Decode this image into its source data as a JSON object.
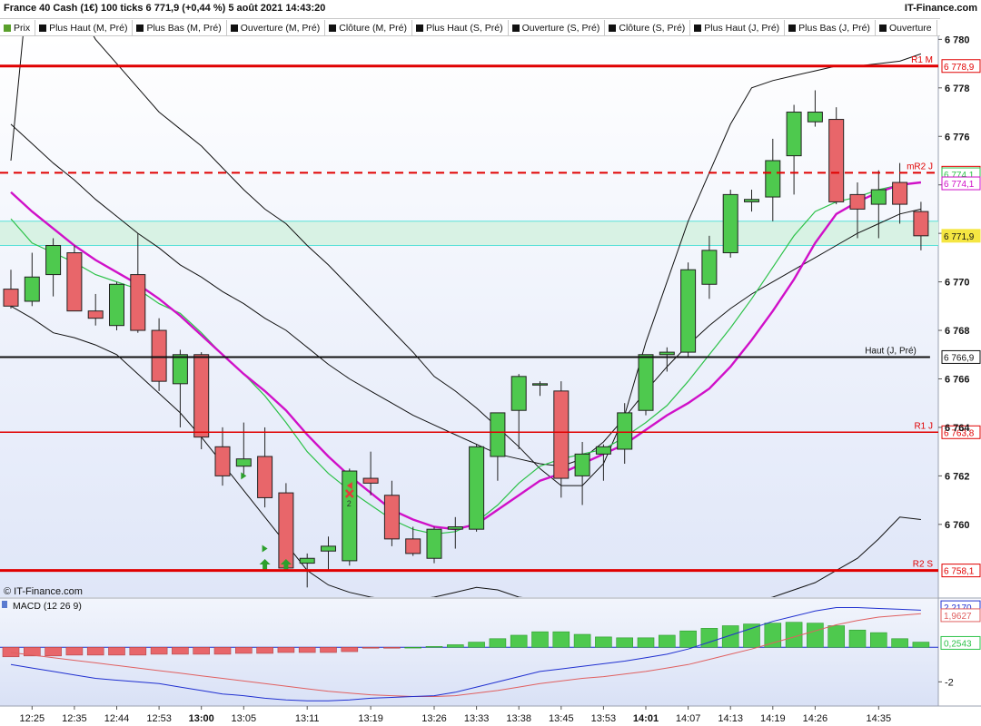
{
  "header": {
    "title": "France 40 Cash (1€) 100 ticks 6 771,9 (+0,44 %) 5 août 2021 14:43:20",
    "brand": "IT-Finance.com"
  },
  "legend": [
    {
      "label": "Prix",
      "color": "#5aa02c"
    },
    {
      "label": "Plus Haut (M, Pré)",
      "color": "#111111"
    },
    {
      "label": "Plus Bas (M, Pré)",
      "color": "#111111"
    },
    {
      "label": "Ouverture (M, Pré)",
      "color": "#111111"
    },
    {
      "label": "Clôture (M, Pré)",
      "color": "#111111"
    },
    {
      "label": "Plus Haut (S, Pré)",
      "color": "#111111"
    },
    {
      "label": "Ouverture (S, Pré)",
      "color": "#111111"
    },
    {
      "label": "Clôture (S, Pré)",
      "color": "#111111"
    },
    {
      "label": "Plus Haut (J, Pré)",
      "color": "#111111"
    },
    {
      "label": "Plus Bas (J, Pré)",
      "color": "#111111"
    },
    {
      "label": "Ouverture",
      "color": "#111111"
    }
  ],
  "colors": {
    "up": "#4ec94e",
    "down": "#e8666a",
    "pivot_red": "#e00000",
    "bollinger": "#111111",
    "ma_fast": "#2ec24a",
    "ma_slow": "#d010c8",
    "band_fill": "#d8f2e4",
    "band_edge": "#58e0d8",
    "macd_line": "#2030d0",
    "signal_line": "#e06060",
    "price_tag": "#f5e642"
  },
  "chart_data": {
    "type": "candlestick",
    "instrument": "France 40 Cash (1€) 100 ticks",
    "y_ticks": [
      {
        "value": 6760,
        "label": "6 760"
      },
      {
        "value": 6762,
        "label": "6 762"
      },
      {
        "value": 6764,
        "label": "6 764"
      },
      {
        "value": 6766,
        "label": "6 766"
      },
      {
        "value": 6768,
        "label": "6 768"
      },
      {
        "value": 6770,
        "label": "6 770"
      },
      {
        "value": 6772,
        "label": "6 772"
      },
      {
        "value": 6774,
        "label": "6 774"
      },
      {
        "value": 6776,
        "label": "6 776"
      },
      {
        "value": 6778,
        "label": "6 778"
      },
      {
        "value": 6780,
        "label": "6 780"
      }
    ],
    "ylim": [
      6757.0,
      6780.5
    ],
    "x_labels": [
      {
        "i": 1,
        "label": "12:25",
        "bold": false
      },
      {
        "i": 3,
        "label": "12:35",
        "bold": false
      },
      {
        "i": 5,
        "label": "12:44",
        "bold": false
      },
      {
        "i": 7,
        "label": "12:53",
        "bold": false
      },
      {
        "i": 9,
        "label": "13:00",
        "bold": true
      },
      {
        "i": 11,
        "label": "13:05",
        "bold": false
      },
      {
        "i": 14,
        "label": "13:11",
        "bold": false
      },
      {
        "i": 17,
        "label": "13:19",
        "bold": false
      },
      {
        "i": 20,
        "label": "13:26",
        "bold": false
      },
      {
        "i": 22,
        "label": "13:33",
        "bold": false
      },
      {
        "i": 24,
        "label": "13:38",
        "bold": false
      },
      {
        "i": 26,
        "label": "13:45",
        "bold": false
      },
      {
        "i": 28,
        "label": "13:53",
        "bold": false
      },
      {
        "i": 30,
        "label": "14:01",
        "bold": true
      },
      {
        "i": 32,
        "label": "14:07",
        "bold": false
      },
      {
        "i": 34,
        "label": "14:13",
        "bold": false
      },
      {
        "i": 36,
        "label": "14:19",
        "bold": false
      },
      {
        "i": 38,
        "label": "14:26",
        "bold": false
      },
      {
        "i": 41,
        "label": "14:35",
        "bold": false
      }
    ],
    "candles": [
      {
        "o": 6769.7,
        "h": 6770.5,
        "l": 6768.9,
        "c": 6769.0
      },
      {
        "o": 6769.2,
        "h": 6771.2,
        "l": 6769.0,
        "c": 6770.2
      },
      {
        "o": 6770.3,
        "h": 6771.8,
        "l": 6769.4,
        "c": 6771.5
      },
      {
        "o": 6771.2,
        "h": 6771.5,
        "l": 6768.8,
        "c": 6768.8
      },
      {
        "o": 6768.8,
        "h": 6769.5,
        "l": 6768.2,
        "c": 6768.5
      },
      {
        "o": 6768.2,
        "h": 6770.0,
        "l": 6768.0,
        "c": 6769.9
      },
      {
        "o": 6770.3,
        "h": 6772.0,
        "l": 6767.9,
        "c": 6768.0
      },
      {
        "o": 6768.0,
        "h": 6768.5,
        "l": 6765.5,
        "c": 6765.9
      },
      {
        "o": 6765.8,
        "h": 6767.2,
        "l": 6764.0,
        "c": 6767.0
      },
      {
        "o": 6767.0,
        "h": 6767.1,
        "l": 6763.1,
        "c": 6763.6
      },
      {
        "o": 6763.2,
        "h": 6764.0,
        "l": 6761.6,
        "c": 6762.0
      },
      {
        "o": 6762.4,
        "h": 6764.2,
        "l": 6762.0,
        "c": 6762.7
      },
      {
        "o": 6762.8,
        "h": 6764.0,
        "l": 6760.7,
        "c": 6761.1
      },
      {
        "o": 6761.3,
        "h": 6761.7,
        "l": 6758.1,
        "c": 6758.2
      },
      {
        "o": 6758.4,
        "h": 6758.8,
        "l": 6757.4,
        "c": 6758.6
      },
      {
        "o": 6758.9,
        "h": 6759.5,
        "l": 6758.1,
        "c": 6759.1
      },
      {
        "o": 6758.5,
        "h": 6762.3,
        "l": 6758.3,
        "c": 6762.2
      },
      {
        "o": 6761.9,
        "h": 6763.0,
        "l": 6761.2,
        "c": 6761.7
      },
      {
        "o": 6761.2,
        "h": 6761.8,
        "l": 6759.1,
        "c": 6759.4
      },
      {
        "o": 6759.4,
        "h": 6759.9,
        "l": 6758.7,
        "c": 6758.8
      },
      {
        "o": 6758.6,
        "h": 6759.9,
        "l": 6758.4,
        "c": 6759.8
      },
      {
        "o": 6759.8,
        "h": 6760.3,
        "l": 6759.0,
        "c": 6759.9
      },
      {
        "o": 6759.8,
        "h": 6763.3,
        "l": 6759.7,
        "c": 6763.2
      },
      {
        "o": 6762.8,
        "h": 6764.3,
        "l": 6761.8,
        "c": 6764.6
      },
      {
        "o": 6764.7,
        "h": 6766.2,
        "l": 6763.1,
        "c": 6766.1
      },
      {
        "o": 6765.8,
        "h": 6765.9,
        "l": 6765.3,
        "c": 6765.8
      },
      {
        "o": 6765.5,
        "h": 6765.9,
        "l": 6761.1,
        "c": 6761.9
      },
      {
        "o": 6762.0,
        "h": 6763.4,
        "l": 6760.8,
        "c": 6762.9
      },
      {
        "o": 6762.9,
        "h": 6763.3,
        "l": 6761.8,
        "c": 6763.2
      },
      {
        "o": 6763.1,
        "h": 6765.0,
        "l": 6762.5,
        "c": 6764.6
      },
      {
        "o": 6764.7,
        "h": 6767.0,
        "l": 6764.5,
        "c": 6767.0
      },
      {
        "o": 6767.0,
        "h": 6767.3,
        "l": 6766.3,
        "c": 6767.1
      },
      {
        "o": 6767.1,
        "h": 6770.8,
        "l": 6766.9,
        "c": 6770.5
      },
      {
        "o": 6769.9,
        "h": 6771.9,
        "l": 6769.3,
        "c": 6771.3
      },
      {
        "o": 6771.2,
        "h": 6773.8,
        "l": 6771.0,
        "c": 6773.6
      },
      {
        "o": 6773.3,
        "h": 6773.8,
        "l": 6772.9,
        "c": 6773.4
      },
      {
        "o": 6773.5,
        "h": 6775.9,
        "l": 6772.5,
        "c": 6775.0
      },
      {
        "o": 6775.2,
        "h": 6777.3,
        "l": 6773.6,
        "c": 6777.0
      },
      {
        "o": 6776.6,
        "h": 6777.9,
        "l": 6776.4,
        "c": 6777.0
      },
      {
        "o": 6776.7,
        "h": 6777.2,
        "l": 6773.2,
        "c": 6773.3
      },
      {
        "o": 6773.6,
        "h": 6774.1,
        "l": 6771.8,
        "c": 6773.0
      },
      {
        "o": 6773.2,
        "h": 6774.6,
        "l": 6771.8,
        "c": 6773.8
      },
      {
        "o": 6774.1,
        "h": 6774.9,
        "l": 6772.4,
        "c": 6773.2
      },
      {
        "o": 6772.9,
        "h": 6773.3,
        "l": 6771.3,
        "c": 6771.9
      }
    ],
    "levels": [
      {
        "value": 6778.9,
        "label": "R1 M",
        "tag": "6 778,9",
        "style": "solid-red"
      },
      {
        "value": 6774.5,
        "label": "mR2 J",
        "tag": "6 774,5",
        "style": "dashed-red"
      },
      {
        "value": 6766.9,
        "label": "Haut (J, Pré)",
        "tag": "6 766,9",
        "style": "solid-black"
      },
      {
        "value": 6763.8,
        "label": "R1 J",
        "tag": "6 763,8",
        "style": "solid-red-thin"
      },
      {
        "value": 6758.1,
        "label": "R2 S",
        "tag": "6 758,1",
        "style": "solid-red"
      }
    ],
    "price_band": [
      6771.5,
      6772.5
    ],
    "value_tags": [
      {
        "value": 6774.1,
        "tag": "6 774,1",
        "color": "#2ec24a"
      },
      {
        "value": 6774.1,
        "tag": "6 774,1",
        "color": "#d010c8"
      },
      {
        "value": 6771.9,
        "tag": "6 771,9",
        "color": "#f5e642"
      }
    ],
    "bollinger_upper": [
      6775.0,
      6784.0,
      6782.5,
      6781.5,
      6780.0,
      6779.0,
      6778.0,
      6777.0,
      6776.3,
      6775.6,
      6774.7,
      6773.8,
      6773.0,
      6772.4,
      6771.5,
      6770.7,
      6769.8,
      6768.9,
      6768.0,
      6767.1,
      6766.1,
      6765.5,
      6764.8,
      6764.0,
      6763.2,
      6762.3,
      6761.6,
      6761.6,
      6762.5,
      6764.5,
      6767.5,
      6770.0,
      6772.5,
      6774.5,
      6776.5,
      6778.0,
      6778.3,
      6778.5,
      6778.7,
      6778.9,
      6778.9,
      6779.0,
      6779.1,
      6779.4
    ],
    "bollinger_middle": [
      6776.5,
      6775.7,
      6774.9,
      6774.2,
      6773.4,
      6772.7,
      6772.0,
      6771.4,
      6770.7,
      6770.2,
      6769.6,
      6769.1,
      6768.5,
      6768.0,
      6767.3,
      6766.6,
      6766.0,
      6765.5,
      6765.0,
      6764.5,
      6764.1,
      6763.7,
      6763.3,
      6762.9,
      6762.7,
      6762.5,
      6762.4,
      6762.7,
      6763.4,
      6764.4,
      6765.5,
      6766.5,
      6767.4,
      6768.2,
      6768.9,
      6769.5,
      6770.0,
      6770.5,
      6771.0,
      6771.5,
      6772.0,
      6772.4,
      6772.8,
      6773.0
    ],
    "bollinger_lower": [
      6769.0,
      6768.5,
      6767.9,
      6767.7,
      6767.4,
      6767.0,
      6766.2,
      6765.4,
      6764.6,
      6763.6,
      6762.5,
      6761.4,
      6760.3,
      6759.2,
      6758.1,
      6757.5,
      6757.2,
      6757.0,
      6756.9,
      6756.9,
      6757.0,
      6757.2,
      6757.4,
      6757.3,
      6757.0,
      6756.9,
      6756.8,
      6756.7,
      6756.6,
      6756.6,
      6756.5,
      6756.5,
      6756.6,
      6756.6,
      6756.6,
      6756.8,
      6757.0,
      6757.3,
      6757.6,
      6758.1,
      6758.6,
      6759.4,
      6760.3,
      6760.2
    ],
    "ma_fast": [
      6772.6,
      6771.6,
      6771.2,
      6770.8,
      6770.3,
      6770.0,
      6769.7,
      6769.1,
      6768.7,
      6767.9,
      6767.0,
      6766.2,
      6765.3,
      6764.2,
      6763.0,
      6762.1,
      6761.4,
      6760.8,
      6760.2,
      6759.8,
      6759.6,
      6759.7,
      6760.1,
      6760.8,
      6761.7,
      6762.4,
      6762.7,
      6762.9,
      6763.1,
      6763.6,
      6764.2,
      6764.9,
      6765.9,
      6767.0,
      6768.1,
      6769.3,
      6770.6,
      6771.9,
      6772.9,
      6773.3,
      6773.5,
      6773.8,
      6774.0,
      6774.1
    ],
    "ma_slow": [
      6773.7,
      6772.9,
      6772.2,
      6771.5,
      6770.9,
      6770.4,
      6769.9,
      6769.3,
      6768.6,
      6767.8,
      6767.0,
      6766.2,
      6765.5,
      6764.7,
      6763.7,
      6762.8,
      6762.0,
      6761.3,
      6760.6,
      6760.2,
      6759.9,
      6759.8,
      6760.0,
      6760.6,
      6761.2,
      6761.8,
      6762.1,
      6762.5,
      6762.9,
      6763.3,
      6763.9,
      6764.5,
      6765.0,
      6765.6,
      6766.5,
      6767.6,
      6768.8,
      6770.1,
      6771.6,
      6772.8,
      6773.3,
      6773.7,
      6774.0,
      6774.1
    ],
    "signals": [
      {
        "i": 12,
        "kind": "arrow-up",
        "color": "#2ca02c"
      },
      {
        "i": 13,
        "kind": "arrow-up",
        "color": "#2ca02c"
      },
      {
        "i": 16,
        "kind": "cross",
        "color": "#e33b3b",
        "label": "2"
      },
      {
        "i": 11,
        "kind": "tri-right",
        "value": 6762.0,
        "color": "#2ca02c"
      },
      {
        "i": 12,
        "kind": "tri-right",
        "value": 6759.0,
        "color": "#2ca02c"
      },
      {
        "i": 16,
        "kind": "tri-left",
        "value": 6761.6,
        "color": "#e33b3b"
      }
    ],
    "watermark": "© IT-Finance.com",
    "macd": {
      "label": "MACD (12 26 9)",
      "histogram": [
        -0.55,
        -0.5,
        -0.5,
        -0.45,
        -0.45,
        -0.45,
        -0.45,
        -0.4,
        -0.4,
        -0.4,
        -0.4,
        -0.35,
        -0.35,
        -0.3,
        -0.3,
        -0.3,
        -0.25,
        -0.05,
        -0.05,
        0.0,
        0.05,
        0.15,
        0.3,
        0.5,
        0.7,
        0.9,
        0.9,
        0.75,
        0.6,
        0.55,
        0.55,
        0.7,
        0.95,
        1.1,
        1.25,
        1.35,
        1.4,
        1.45,
        1.4,
        1.25,
        1.0,
        0.85,
        0.5,
        0.3
      ],
      "macd_line": [
        -1.0,
        -1.2,
        -1.4,
        -1.6,
        -1.8,
        -1.9,
        -2.0,
        -2.1,
        -2.3,
        -2.5,
        -2.7,
        -2.8,
        -2.95,
        -3.05,
        -3.1,
        -3.1,
        -3.05,
        -2.95,
        -2.9,
        -2.85,
        -2.8,
        -2.6,
        -2.3,
        -2.0,
        -1.7,
        -1.4,
        -1.25,
        -1.1,
        -0.95,
        -0.8,
        -0.6,
        -0.4,
        -0.1,
        0.3,
        0.7,
        1.1,
        1.5,
        1.8,
        2.1,
        2.3,
        2.3,
        2.25,
        2.2,
        2.15
      ],
      "signal_line": [
        -0.3,
        -0.45,
        -0.6,
        -0.75,
        -0.9,
        -1.05,
        -1.2,
        -1.35,
        -1.5,
        -1.65,
        -1.8,
        -1.95,
        -2.1,
        -2.25,
        -2.4,
        -2.55,
        -2.65,
        -2.75,
        -2.8,
        -2.85,
        -2.85,
        -2.8,
        -2.65,
        -2.5,
        -2.3,
        -2.1,
        -1.95,
        -1.8,
        -1.7,
        -1.55,
        -1.4,
        -1.2,
        -1.0,
        -0.7,
        -0.4,
        -0.1,
        0.25,
        0.6,
        0.95,
        1.3,
        1.55,
        1.75,
        1.85,
        1.95
      ],
      "y_ticks": [
        {
          "value": -2,
          "label": "-2"
        }
      ],
      "ylim": [
        -3.4,
        2.8
      ],
      "value_tags": [
        {
          "value": 2.217,
          "tag": "2,2170",
          "color": "#2030d0"
        },
        {
          "value": 1.9627,
          "tag": "1,9627",
          "color": "#e06060"
        },
        {
          "value": 0.2543,
          "tag": "0,2543",
          "color": "#2ec24a"
        }
      ]
    }
  }
}
